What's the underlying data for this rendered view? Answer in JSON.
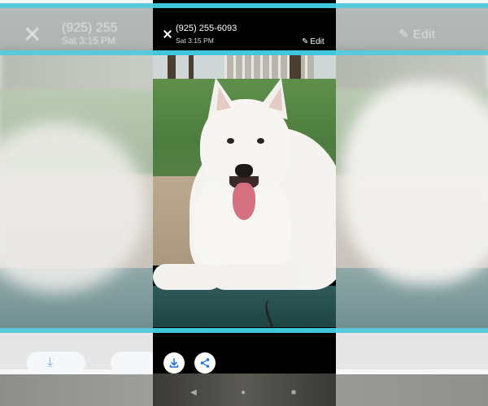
{
  "header": {
    "phone_number": "(925) 255-6093",
    "timestamp": "Sat 3:15 PM",
    "edit_label": "Edit"
  },
  "background_ghost": {
    "phone_number": "(925) 255",
    "timestamp": "Sat 3:15 PM",
    "edit_label": "Edit"
  },
  "icons": {
    "close": "close-icon",
    "edit": "pencil-icon",
    "download": "download-icon",
    "share": "share-icon",
    "back": "back-icon",
    "home": "home-icon",
    "recent": "recent-apps-icon"
  },
  "colors": {
    "accent_cyan": "#3fc6dc",
    "topbar": "#000000",
    "icon_blue": "#1a73e8"
  }
}
